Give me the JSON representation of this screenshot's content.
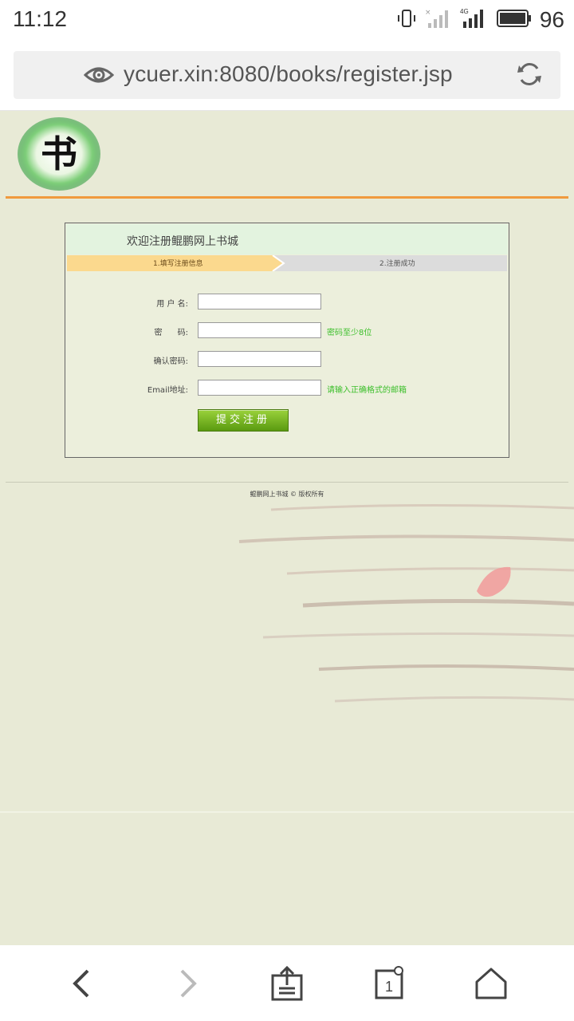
{
  "status_bar": {
    "time": "11:12",
    "battery_percent": "96",
    "network_label": "4G"
  },
  "browser": {
    "url": "ycuer.xin:8080/books/register.jsp"
  },
  "page": {
    "logo_alt": "书",
    "register": {
      "title": "欢迎注册鲲鹏网上书城",
      "steps": [
        {
          "label": "1.填写注册信息",
          "active": true
        },
        {
          "label": "2.注册成功",
          "active": false
        }
      ],
      "fields": {
        "username": {
          "label": "用 户 名:",
          "value": ""
        },
        "password": {
          "label": "密      码:",
          "value": "",
          "hint": "密码至少8位"
        },
        "confirm": {
          "label": "确认密码:",
          "value": ""
        },
        "email": {
          "label": "Email地址:",
          "value": "",
          "hint": "请输入正确格式的邮箱"
        }
      },
      "submit_label": "提交注册"
    },
    "footer": "鲲鹏网上书城 © 版权所有"
  },
  "colors": {
    "accent_line": "#f09a3e",
    "hint_green": "#3bbf2a",
    "button_green": "#6aaa18",
    "page_bg": "#e8ead6"
  }
}
